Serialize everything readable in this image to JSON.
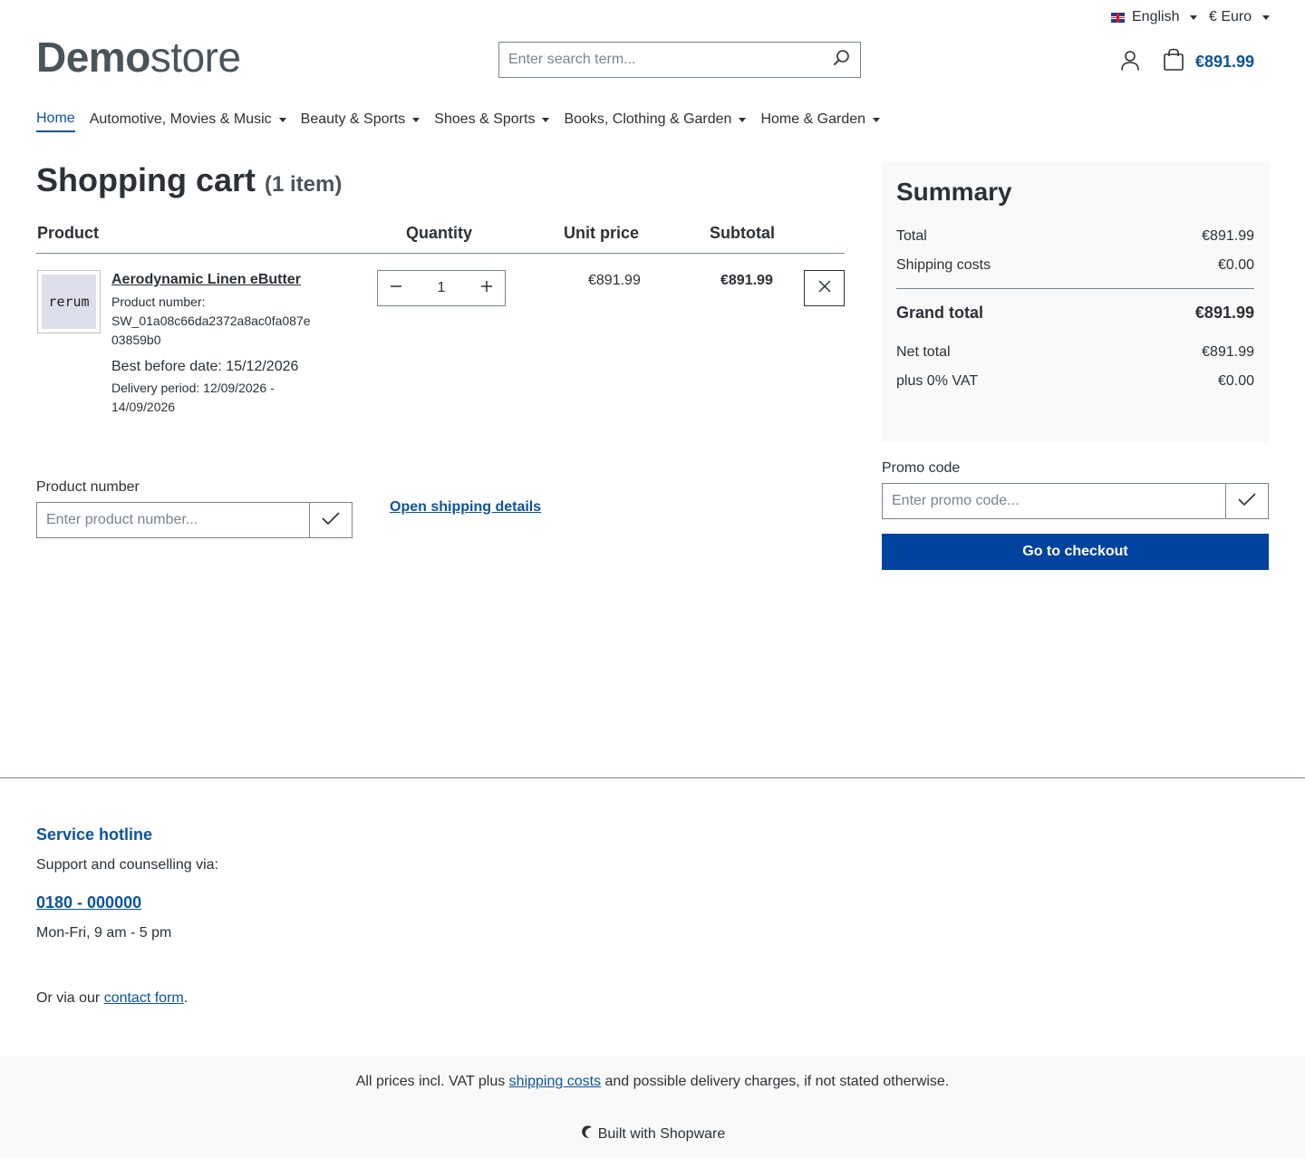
{
  "topbar": {
    "language": "English",
    "currency": "€ Euro"
  },
  "header": {
    "logo_bold": "Demo",
    "logo_light": "store",
    "search_placeholder": "Enter search term...",
    "cart_total": "€891.99"
  },
  "nav": {
    "items": [
      {
        "label": "Home"
      },
      {
        "label": "Automotive, Movies & Music"
      },
      {
        "label": "Beauty & Sports"
      },
      {
        "label": "Shoes & Sports"
      },
      {
        "label": "Books, Clothing & Garden"
      },
      {
        "label": "Home & Garden"
      }
    ]
  },
  "cart": {
    "title": "Shopping cart",
    "count": "(1 item)",
    "headers": {
      "product": "Product",
      "quantity": "Quantity",
      "unit_price": "Unit price",
      "subtotal": "Subtotal"
    },
    "item": {
      "thumb_text": "rerum",
      "name": "Aerodynamic Linen eButter",
      "number_label": "Product number:",
      "number_line1": "SW_01a08c66da2372a8ac0fa087e",
      "number_line2": "03859b0",
      "best_before": "Best before date: 15/12/2026",
      "delivery_line1": "Delivery period: 12/09/2026 -",
      "delivery_line2": "14/09/2026",
      "quantity": "1",
      "unit_price": "€891.99",
      "subtotal": "€891.99"
    },
    "product_number_label": "Product number",
    "product_number_placeholder": "Enter product number...",
    "shipping_link": "Open shipping details"
  },
  "summary": {
    "title": "Summary",
    "total_label": "Total",
    "total_value": "€891.99",
    "shipping_label": "Shipping costs",
    "shipping_value": "€0.00",
    "grand_label": "Grand total",
    "grand_value": "€891.99",
    "net_label": "Net total",
    "net_value": "€891.99",
    "vat_label": "plus 0% VAT",
    "vat_value": "€0.00",
    "promo_label": "Promo code",
    "promo_placeholder": "Enter promo code...",
    "checkout_label": "Go to checkout"
  },
  "footer": {
    "hotline_title": "Service hotline",
    "support_text": "Support and counselling via:",
    "phone": "0180 - 000000",
    "hours": "Mon-Fri, 9 am - 5 pm",
    "contact_prefix": "Or via our ",
    "contact_link": "contact form",
    "contact_suffix": ".",
    "vat_prefix": "All prices incl. VAT plus ",
    "vat_link": "shipping costs",
    "vat_suffix": " and possible delivery charges, if not stated otherwise.",
    "built_with": "Built with Shopware"
  }
}
